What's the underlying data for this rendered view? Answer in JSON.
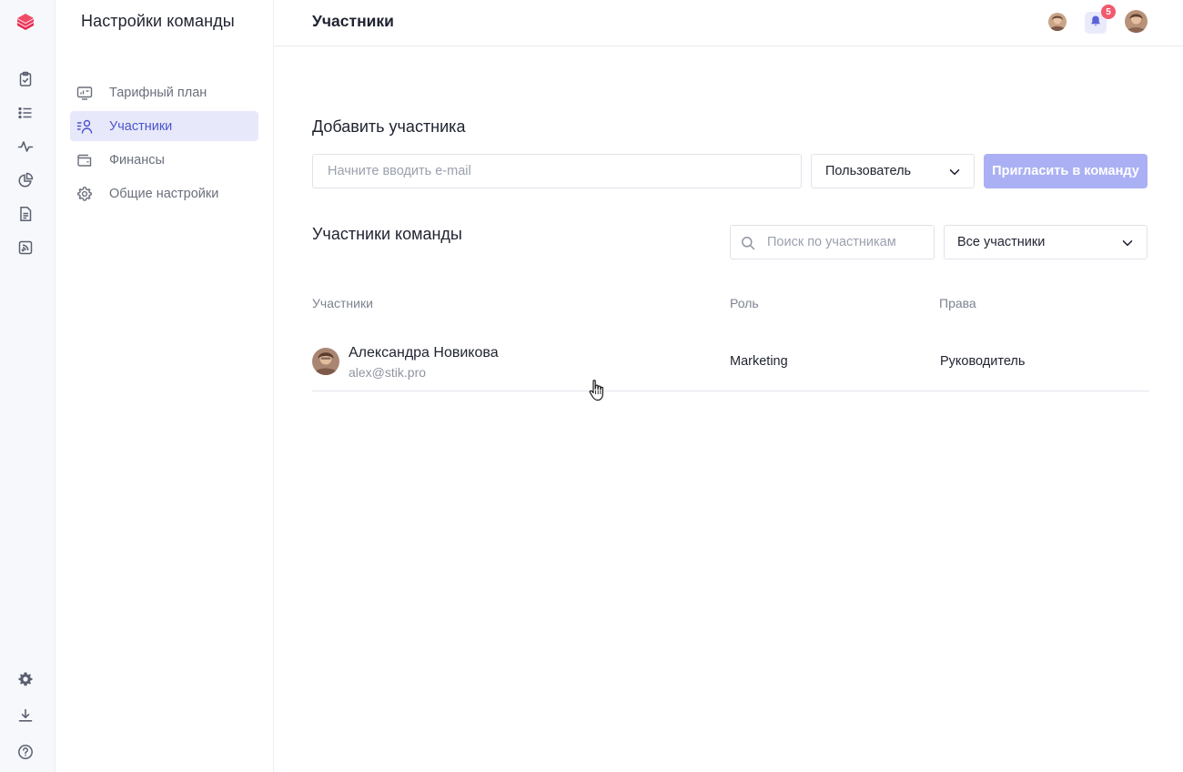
{
  "rail": {
    "logo": "stik-logo-icon",
    "top_icons": [
      "clipboard-check-icon",
      "list-icon",
      "activity-icon",
      "pie-chart-icon",
      "document-icon",
      "rss-icon"
    ],
    "bottom_icons": [
      "gear-icon",
      "download-icon",
      "help-icon"
    ]
  },
  "sidebar": {
    "title": "Настройки команды",
    "items": [
      {
        "label": "Тарифный план",
        "icon": "tariff-icon",
        "active": false
      },
      {
        "label": "Участники",
        "icon": "users-icon",
        "active": true
      },
      {
        "label": "Финансы",
        "icon": "wallet-icon",
        "active": false
      },
      {
        "label": "Общие настройки",
        "icon": "gear-icon",
        "active": false
      }
    ]
  },
  "header": {
    "title": "Участники",
    "notifications_count": "5"
  },
  "add_member": {
    "title": "Добавить участника",
    "email_placeholder": "Начните вводить e-mail",
    "role_value": "Пользователь",
    "invite_label": "Пригласить в команду"
  },
  "team": {
    "title": "Участники команды",
    "search_placeholder": "Поиск по участникам",
    "filter_value": "Все участники",
    "columns": [
      "Участники",
      "Роль",
      "Права"
    ],
    "rows": [
      {
        "name": "Александра Новикова",
        "email": "alex@stik.pro",
        "role": "Marketing",
        "rights": "Руководитель"
      }
    ]
  },
  "colors": {
    "accent": "#4d54c9",
    "active_bg": "#e7e9fb",
    "invite_disabled": "#aab0f3",
    "badge": "#f25a6e",
    "logo": "#e8294f"
  }
}
